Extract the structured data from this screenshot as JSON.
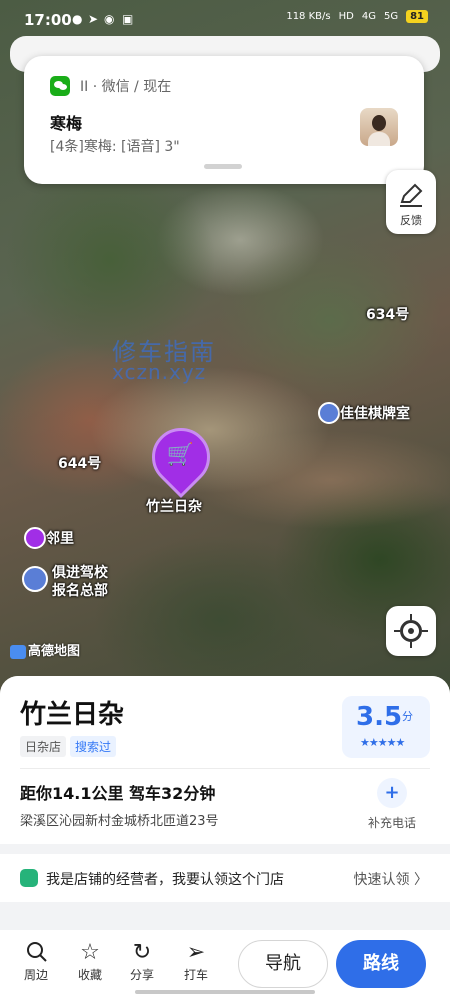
{
  "status_bar": {
    "time": "17:00",
    "net_speed": "118 KB/s",
    "hd": "HD",
    "signal1": "4G",
    "signal2": "5G",
    "battery": "81"
  },
  "notification": {
    "app": "II · 微信 / 现在",
    "sender": "寒梅",
    "message": "[4条]寒梅: [语音] 3\""
  },
  "map": {
    "feedback_label": "反馈",
    "watermark_line1": "修车指南",
    "watermark_line2": "xczn.xyz",
    "labels": {
      "house_634": "634号",
      "house_644": "644号",
      "chess_room": "佳佳棋牌室",
      "shop_pin": "竹兰日杂",
      "neighbor": "邻里",
      "driving_school_1": "俱进驾校",
      "driving_school_2": "报名总部"
    },
    "logo_text": "高德地图"
  },
  "poi": {
    "name": "竹兰日杂",
    "tags": [
      "日杂店",
      "搜索过"
    ],
    "rating": {
      "value": "3.5",
      "unit": "分",
      "stars": "★★★★★"
    },
    "distance": "距你14.1公里  驾车32分钟",
    "address": "梁溪区沁园新村金城桥北匝道23号",
    "add_phone": "补充电话",
    "claim_text": "我是店铺的经营者，我要认领这个门店",
    "claim_action": "快速认领 〉"
  },
  "bottom_bar": {
    "items": [
      {
        "label": "周边",
        "icon": "search-icon"
      },
      {
        "label": "收藏",
        "icon": "star-icon"
      },
      {
        "label": "分享",
        "icon": "share-icon"
      },
      {
        "label": "打车",
        "icon": "taxi-icon"
      }
    ],
    "nav": "导航",
    "route": "路线"
  },
  "colors": {
    "accent": "#2f6ee8",
    "pin": "#a12ee6"
  }
}
